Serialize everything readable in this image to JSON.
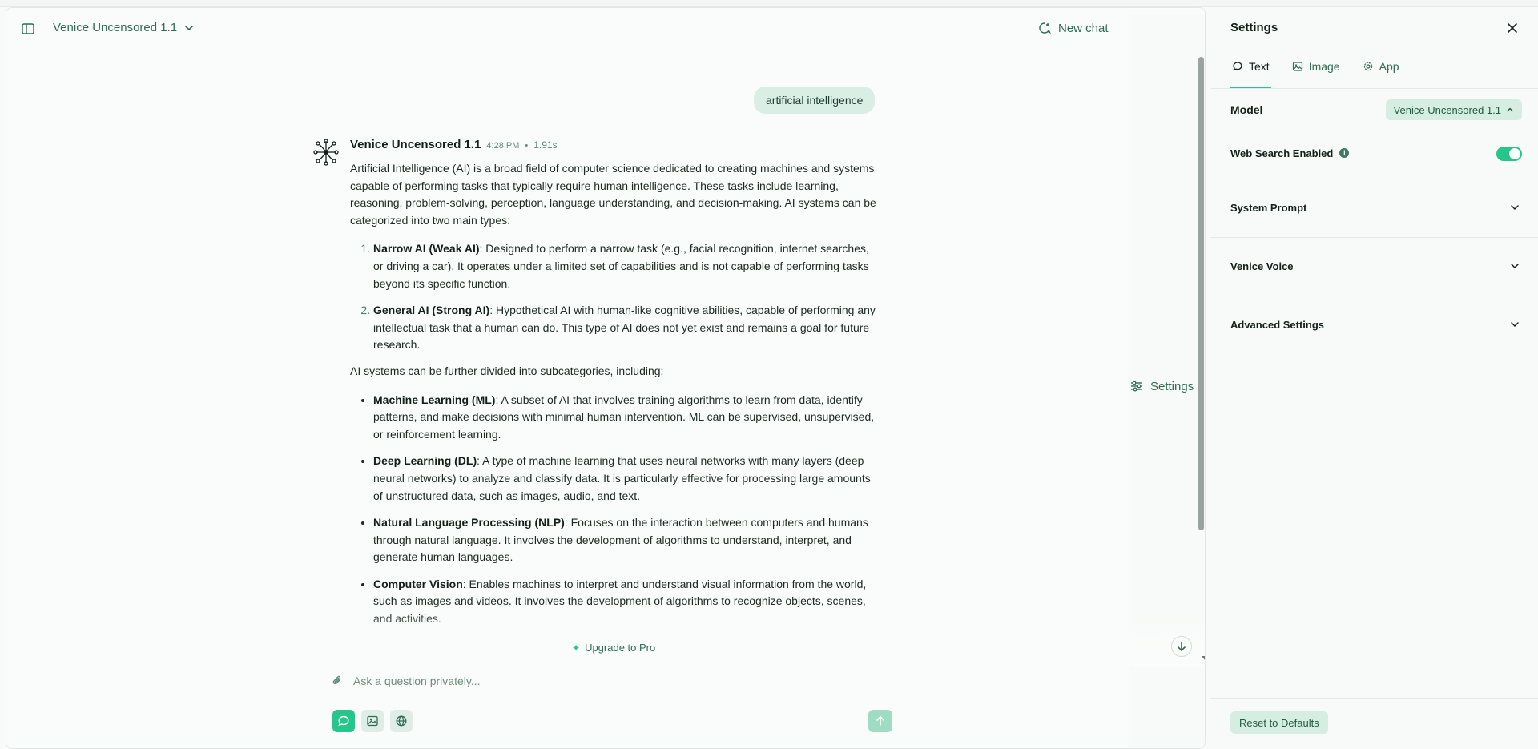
{
  "header": {
    "model_name": "Venice Uncensored 1.1",
    "new_chat_label": "New chat",
    "settings_label": "Settings"
  },
  "chat": {
    "user_message": "artificial intelligence",
    "ai": {
      "name": "Venice Uncensored 1.1",
      "time": "4:28 PM",
      "separator": "•",
      "duration": "1.91s",
      "intro": "Artificial Intelligence (AI) is a broad field of computer science dedicated to creating machines and systems capable of performing tasks that typically require human intelligence. These tasks include learning, reasoning, problem-solving, perception, language understanding, and decision-making. AI systems can be categorized into two main types:",
      "types": [
        {
          "term": "Narrow AI (Weak AI)",
          "text": ": Designed to perform a narrow task (e.g., facial recognition, internet searches, or driving a car). It operates under a limited set of capabilities and is not capable of performing tasks beyond its specific function."
        },
        {
          "term": "General AI (Strong AI)",
          "text": ": Hypothetical AI with human-like cognitive abilities, capable of performing any intellectual task that a human can do. This type of AI does not yet exist and remains a goal for future research."
        }
      ],
      "subcategories_intro": "AI systems can be further divided into subcategories, including:",
      "subcategories": [
        {
          "term": "Machine Learning (ML)",
          "text": ": A subset of AI that involves training algorithms to learn from data, identify patterns, and make decisions with minimal human intervention. ML can be supervised, unsupervised, or reinforcement learning."
        },
        {
          "term": "Deep Learning (DL)",
          "text": ": A type of machine learning that uses neural networks with many layers (deep neural networks) to analyze and classify data. It is particularly effective for processing large amounts of unstructured data, such as images, audio, and text."
        },
        {
          "term": "Natural Language Processing (NLP)",
          "text": ": Focuses on the interaction between computers and humans through natural language. It involves the development of algorithms to understand, interpret, and generate human languages."
        },
        {
          "term": "Computer Vision",
          "text": ": Enables machines to interpret and understand visual information from the world, such as images and videos. It involves the development of algorithms to recognize objects, scenes, and activities."
        }
      ]
    },
    "upgrade_label": "Upgrade to Pro"
  },
  "composer": {
    "placeholder": "Ask a question privately..."
  },
  "settings_panel": {
    "title": "Settings",
    "tabs": [
      {
        "label": "Text",
        "icon": "chat-bubble-icon",
        "active": true
      },
      {
        "label": "Image",
        "icon": "image-icon",
        "active": false
      },
      {
        "label": "App",
        "icon": "gear-icon",
        "active": false
      }
    ],
    "model_label": "Model",
    "model_value": "Venice Uncensored 1.1",
    "web_search_label": "Web Search Enabled",
    "web_search_enabled": true,
    "system_prompt_label": "System Prompt",
    "venice_voice_label": "Venice Voice",
    "advanced_settings_label": "Advanced Settings",
    "reset_label": "Reset to Defaults"
  },
  "colors": {
    "accent": "#26c58a",
    "text_green": "#2e6d52",
    "bubble": "#d9efe5"
  }
}
